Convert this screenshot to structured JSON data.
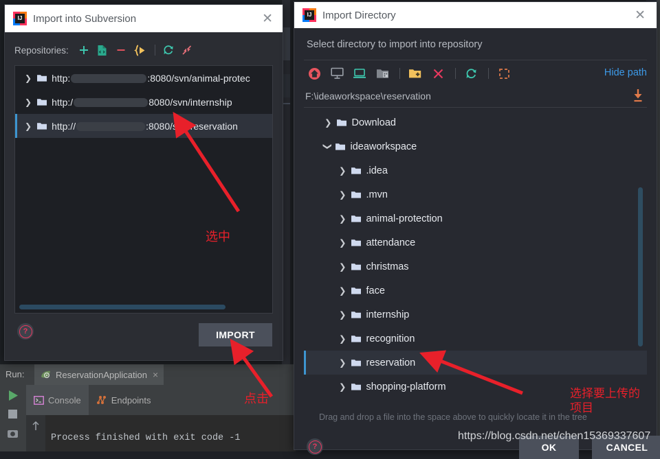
{
  "background": {
    "run": {
      "label": "Run:",
      "tab_name": "ReservationApplication",
      "tab_close": "×",
      "subtabs": [
        {
          "label": "Console",
          "icon": "console-icon",
          "active": true
        },
        {
          "label": "Endpoints",
          "icon": "endpoints-icon",
          "active": false
        }
      ],
      "console_output": "Process finished with exit code -1"
    }
  },
  "left_dialog": {
    "title": "Import into Subversion",
    "close_label": "✕",
    "repositories_label": "Repositories:",
    "toolbar": [
      {
        "name": "add-repository-button",
        "glyph": "+",
        "color": "#3ec9b0"
      },
      {
        "name": "add-repository-location-button",
        "glyph": "file",
        "color": "#3ec9b0"
      },
      {
        "name": "remove-repository-button",
        "glyph": "−",
        "color": "#e8555f"
      },
      {
        "name": "browse-branches-button",
        "glyph": "branch",
        "color": "#f2c15c"
      },
      {
        "name": "refresh-button",
        "glyph": "refresh",
        "color": "#3ec9b0"
      },
      {
        "name": "collapse-all-button",
        "glyph": "collapse",
        "color": "#e8707a"
      }
    ],
    "repositories": [
      {
        "prefix": "http:",
        "suffix": ":8080/svn/animal-protec",
        "redacted": true,
        "selected": false,
        "truncated": true
      },
      {
        "prefix": "http:/",
        "suffix": "8080/svn/internship",
        "redacted": true,
        "selected": false,
        "truncated": false
      },
      {
        "prefix": "http://",
        "suffix": ":8080/svn/reservation",
        "redacted": true,
        "selected": true,
        "truncated": false
      }
    ],
    "import_button": "IMPORT",
    "help_glyph": "?"
  },
  "right_dialog": {
    "title": "Import Directory",
    "close_label": "✕",
    "subtitle": "Select directory to import into repository",
    "toolbar": [
      {
        "name": "home-directory-button",
        "icon": "home-icon",
        "color": "#e8555f"
      },
      {
        "name": "desktop-button",
        "icon": "desktop-icon",
        "color": "#9aa0a8"
      },
      {
        "name": "laptop-button",
        "icon": "laptop-icon",
        "color": "#3ec9b0"
      },
      {
        "name": "project-directory-button",
        "icon": "project-folder-icon",
        "color": "#9aa0a8"
      },
      {
        "name": "new-folder-button",
        "icon": "new-folder-icon",
        "color": "#f2c15c"
      },
      {
        "name": "delete-button",
        "icon": "close-x-icon",
        "color": "#e8395f"
      },
      {
        "name": "refresh-button",
        "icon": "refresh-icon",
        "color": "#3ec9b0"
      },
      {
        "name": "toggle-selection-button",
        "icon": "dashed-square-icon",
        "color": "#e07a4a"
      }
    ],
    "hide_path_label": "Hide path",
    "path_value": "F:\\ideaworkspace\\reservation",
    "download_icon": "download-icon",
    "tree": [
      {
        "label": "Download",
        "depth": 1,
        "state": "collapsed",
        "selected": false
      },
      {
        "label": "ideaworkspace",
        "depth": 1,
        "state": "expanded",
        "selected": false
      },
      {
        "label": ".idea",
        "depth": 2,
        "state": "collapsed",
        "selected": false
      },
      {
        "label": ".mvn",
        "depth": 2,
        "state": "collapsed",
        "selected": false
      },
      {
        "label": "animal-protection",
        "depth": 2,
        "state": "collapsed",
        "selected": false
      },
      {
        "label": "attendance",
        "depth": 2,
        "state": "collapsed",
        "selected": false
      },
      {
        "label": "christmas",
        "depth": 2,
        "state": "collapsed",
        "selected": false
      },
      {
        "label": "face",
        "depth": 2,
        "state": "collapsed",
        "selected": false
      },
      {
        "label": "internship",
        "depth": 2,
        "state": "collapsed",
        "selected": false
      },
      {
        "label": "recognition",
        "depth": 2,
        "state": "collapsed",
        "selected": false
      },
      {
        "label": "reservation",
        "depth": 2,
        "state": "collapsed",
        "selected": true
      },
      {
        "label": "shopping-platform",
        "depth": 2,
        "state": "collapsed",
        "selected": false
      }
    ],
    "drag_hint": "Drag and drop a file into the space above to quickly locate it in the tree",
    "ok_label": "OK",
    "cancel_label": "CANCEL",
    "help_glyph": "?"
  },
  "annotations": {
    "color": "#e8202a",
    "select_note": "选中",
    "click_note": "点击",
    "choose_upload_note": "选择要上传的\n项目",
    "watermark": "https://blog.csdn.net/chen15369337607"
  }
}
